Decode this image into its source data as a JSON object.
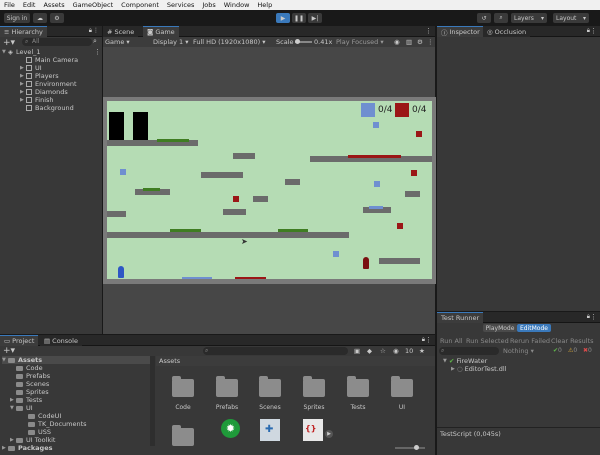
{
  "menu": [
    "File",
    "Edit",
    "Assets",
    "GameObject",
    "Component",
    "Services",
    "Jobs",
    "Window",
    "Help"
  ],
  "toolbar": {
    "sign_in": "Sign in",
    "layers": "Layers",
    "layout": "Layout"
  },
  "hierarchy": {
    "tab": "Hierarchy",
    "search_placeholder": "All",
    "scene": "Level_1",
    "items": [
      "Main Camera",
      "UI",
      "Players",
      "Environment",
      "Diamonds",
      "Finish",
      "Background"
    ]
  },
  "scene_tabs": {
    "scene": "Scene",
    "game": "Game"
  },
  "game_bar": {
    "mode": "Game",
    "display": "Display 1",
    "resolution": "Full HD (1920x1080)",
    "scale_label": "Scale",
    "scale_value": "0.41x",
    "play_focused": "Play Focused"
  },
  "game": {
    "blue_counter": "0/4",
    "red_counter": "0/4"
  },
  "inspector": {
    "tab": "Inspector",
    "occlusion": "Occlusion"
  },
  "test_runner": {
    "tab": "Test Runner",
    "playmode": "PlayMode",
    "editmode": "EditMode",
    "run_all": "Run All",
    "run_selected": "Run Selected",
    "rerun_failed": "Rerun Failed",
    "clear_results": "Clear Results",
    "filter": "Nothing",
    "pass_count": "0",
    "skip_count": "0",
    "fail_count": "0",
    "tree_root": "FireWater",
    "tree_child": "EditorTest.dll",
    "status": "TestScript (0,045s)"
  },
  "project": {
    "tab": "Project",
    "console_tab": "Console",
    "assets_root": "Assets",
    "tree": [
      "Code",
      "Prefabs",
      "Scenes",
      "Sprites",
      "Tests",
      "UI",
      "CodeUI",
      "TK_Documents",
      "USS",
      "UI Toolkit"
    ],
    "packages": "Packages",
    "breadcrumb": "Assets",
    "hidden_count": "10",
    "grid": [
      "Code",
      "Prefabs",
      "Scenes",
      "Sprites",
      "Tests",
      "UI"
    ]
  },
  "colors": {
    "accent": "#3a79bb",
    "game_bg": "#b5dcb4",
    "blue_diamond": "#6f8fd0",
    "red_diamond": "#9b1616"
  }
}
